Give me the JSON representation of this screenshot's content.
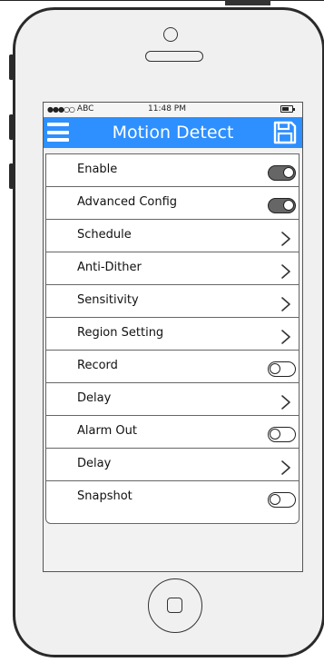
{
  "status_bar": {
    "carrier": "ABC",
    "time": "11:48 PM",
    "battery_level": 0.7
  },
  "navbar": {
    "title": "Motion Detect",
    "menu_icon": "hamburger-icon",
    "save_icon": "floppy-disk-icon",
    "accent_color": "#2e8fff"
  },
  "settings": {
    "rows": [
      {
        "label": "Enable",
        "control": "toggle",
        "on": true
      },
      {
        "label": "Advanced Config",
        "control": "toggle",
        "on": true
      },
      {
        "label": "Schedule",
        "control": "chevron"
      },
      {
        "label": "Anti-Dither",
        "control": "chevron"
      },
      {
        "label": "Sensitivity",
        "control": "chevron"
      },
      {
        "label": "Region Setting",
        "control": "chevron"
      },
      {
        "label": "Record",
        "control": "toggle",
        "on": false
      },
      {
        "label": "Delay",
        "control": "chevron"
      },
      {
        "label": "Alarm Out",
        "control": "toggle",
        "on": false
      },
      {
        "label": "Delay",
        "control": "chevron"
      },
      {
        "label": "Snapshot",
        "control": "toggle",
        "on": false
      }
    ]
  }
}
